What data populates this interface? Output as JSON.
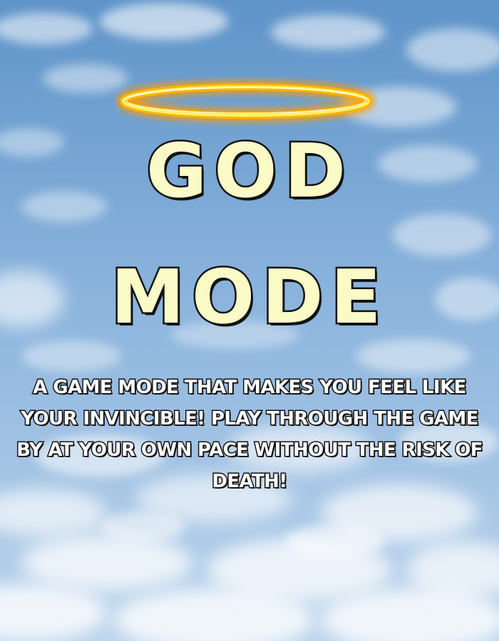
{
  "title": {
    "line1": "GOD",
    "line2": "MODE"
  },
  "description": "A GAME MODE THAT MAKES YOU FEEL LIKE YOUR INVINCIBLE! PLAY THROUGH THE GAME BY AT YOUR OWN PACE WITHOUT THE RISK OF DEATH!",
  "icons": {
    "halo": "halo-icon"
  },
  "colors": {
    "sky_top": "#5f94c9",
    "sky_bottom": "#bcd4ec",
    "title_fill": "#fbfbc7",
    "outline": "#121212",
    "halo_gold": "#ffb400",
    "halo_glow": "#fff36b",
    "description_fill": "#ffffff"
  }
}
